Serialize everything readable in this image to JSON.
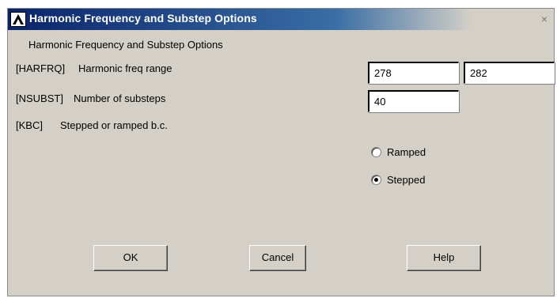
{
  "window": {
    "title": "Harmonic Frequency and Substep Options",
    "close_glyph": "×",
    "logo_icon": "ansys-logo-icon"
  },
  "subtitle": "Harmonic Frequency and Substep Options",
  "harfrq": {
    "code": "[HARFRQ]",
    "description": "Harmonic freq range",
    "value_start": "278",
    "value_end": "282"
  },
  "nsubst": {
    "code": "[NSUBST]",
    "description": "Number of substeps",
    "value": "40"
  },
  "kbc": {
    "code": "[KBC]",
    "description": "Stepped or ramped b.c.",
    "options": [
      {
        "label": "Ramped",
        "selected": false
      },
      {
        "label": "Stepped",
        "selected": true
      }
    ]
  },
  "buttons": {
    "ok": "OK",
    "cancel": "Cancel",
    "help": "Help"
  },
  "colors": {
    "title_bar_start": "#0a246a",
    "title_bar_end": "#3a6ea5",
    "dialog_bg": "#d4d0c8"
  }
}
